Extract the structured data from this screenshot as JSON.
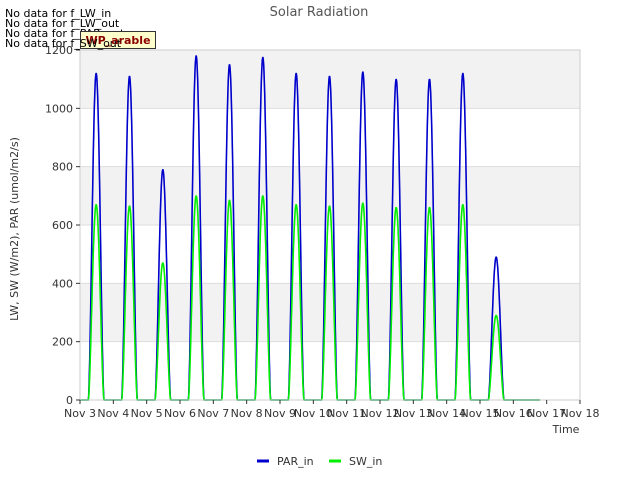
{
  "nodata_messages": [
    "No data for f_LW_in",
    "No data for f_LW_out",
    "No data for f_PAR_out",
    "No data for f_SW_out"
  ],
  "badge_label": "WP_arable",
  "chart_data": {
    "type": "line",
    "title": "Solar Radiation",
    "xlabel": "Time",
    "ylabel": "LW, SW (W/m2), PAR (umol/m2/s)",
    "ylim": [
      0,
      1200
    ],
    "xlim": [
      "Nov 3",
      "Nov 18"
    ],
    "yticks": [
      0,
      200,
      400,
      600,
      800,
      1000,
      1200
    ],
    "xticks": [
      "Nov 3",
      "Nov 4",
      "Nov 5",
      "Nov 6",
      "Nov 7",
      "Nov 8",
      "Nov 9",
      "Nov 10",
      "Nov 11",
      "Nov 12",
      "Nov 13",
      "Nov 14",
      "Nov 15",
      "Nov 16",
      "Nov 17",
      "Nov 18"
    ],
    "grid": true,
    "background_bands": true,
    "legend_position": "bottom-center",
    "series": [
      {
        "name": "PAR_in",
        "color": "#0000cc",
        "daily_peaks": [
          {
            "date": "Nov 3",
            "peak": 1120
          },
          {
            "date": "Nov 4",
            "peak": 1110
          },
          {
            "date": "Nov 5",
            "peak": 790
          },
          {
            "date": "Nov 6",
            "peak": 1180
          },
          {
            "date": "Nov 7",
            "peak": 1150
          },
          {
            "date": "Nov 8",
            "peak": 1175
          },
          {
            "date": "Nov 9",
            "peak": 1120
          },
          {
            "date": "Nov 10",
            "peak": 1110
          },
          {
            "date": "Nov 11",
            "peak": 1125
          },
          {
            "date": "Nov 12",
            "peak": 1100
          },
          {
            "date": "Nov 13",
            "peak": 1100
          },
          {
            "date": "Nov 14",
            "peak": 1120
          },
          {
            "date": "Nov 15",
            "peak": 490
          }
        ]
      },
      {
        "name": "SW_in",
        "color": "#00ee00",
        "daily_peaks": [
          {
            "date": "Nov 3",
            "peak": 670
          },
          {
            "date": "Nov 4",
            "peak": 665
          },
          {
            "date": "Nov 5",
            "peak": 470
          },
          {
            "date": "Nov 6",
            "peak": 700
          },
          {
            "date": "Nov 7",
            "peak": 685
          },
          {
            "date": "Nov 8",
            "peak": 700
          },
          {
            "date": "Nov 9",
            "peak": 670
          },
          {
            "date": "Nov 10",
            "peak": 665
          },
          {
            "date": "Nov 11",
            "peak": 675
          },
          {
            "date": "Nov 12",
            "peak": 660
          },
          {
            "date": "Nov 13",
            "peak": 660
          },
          {
            "date": "Nov 14",
            "peak": 670
          },
          {
            "date": "Nov 15",
            "peak": 290
          }
        ]
      }
    ]
  }
}
